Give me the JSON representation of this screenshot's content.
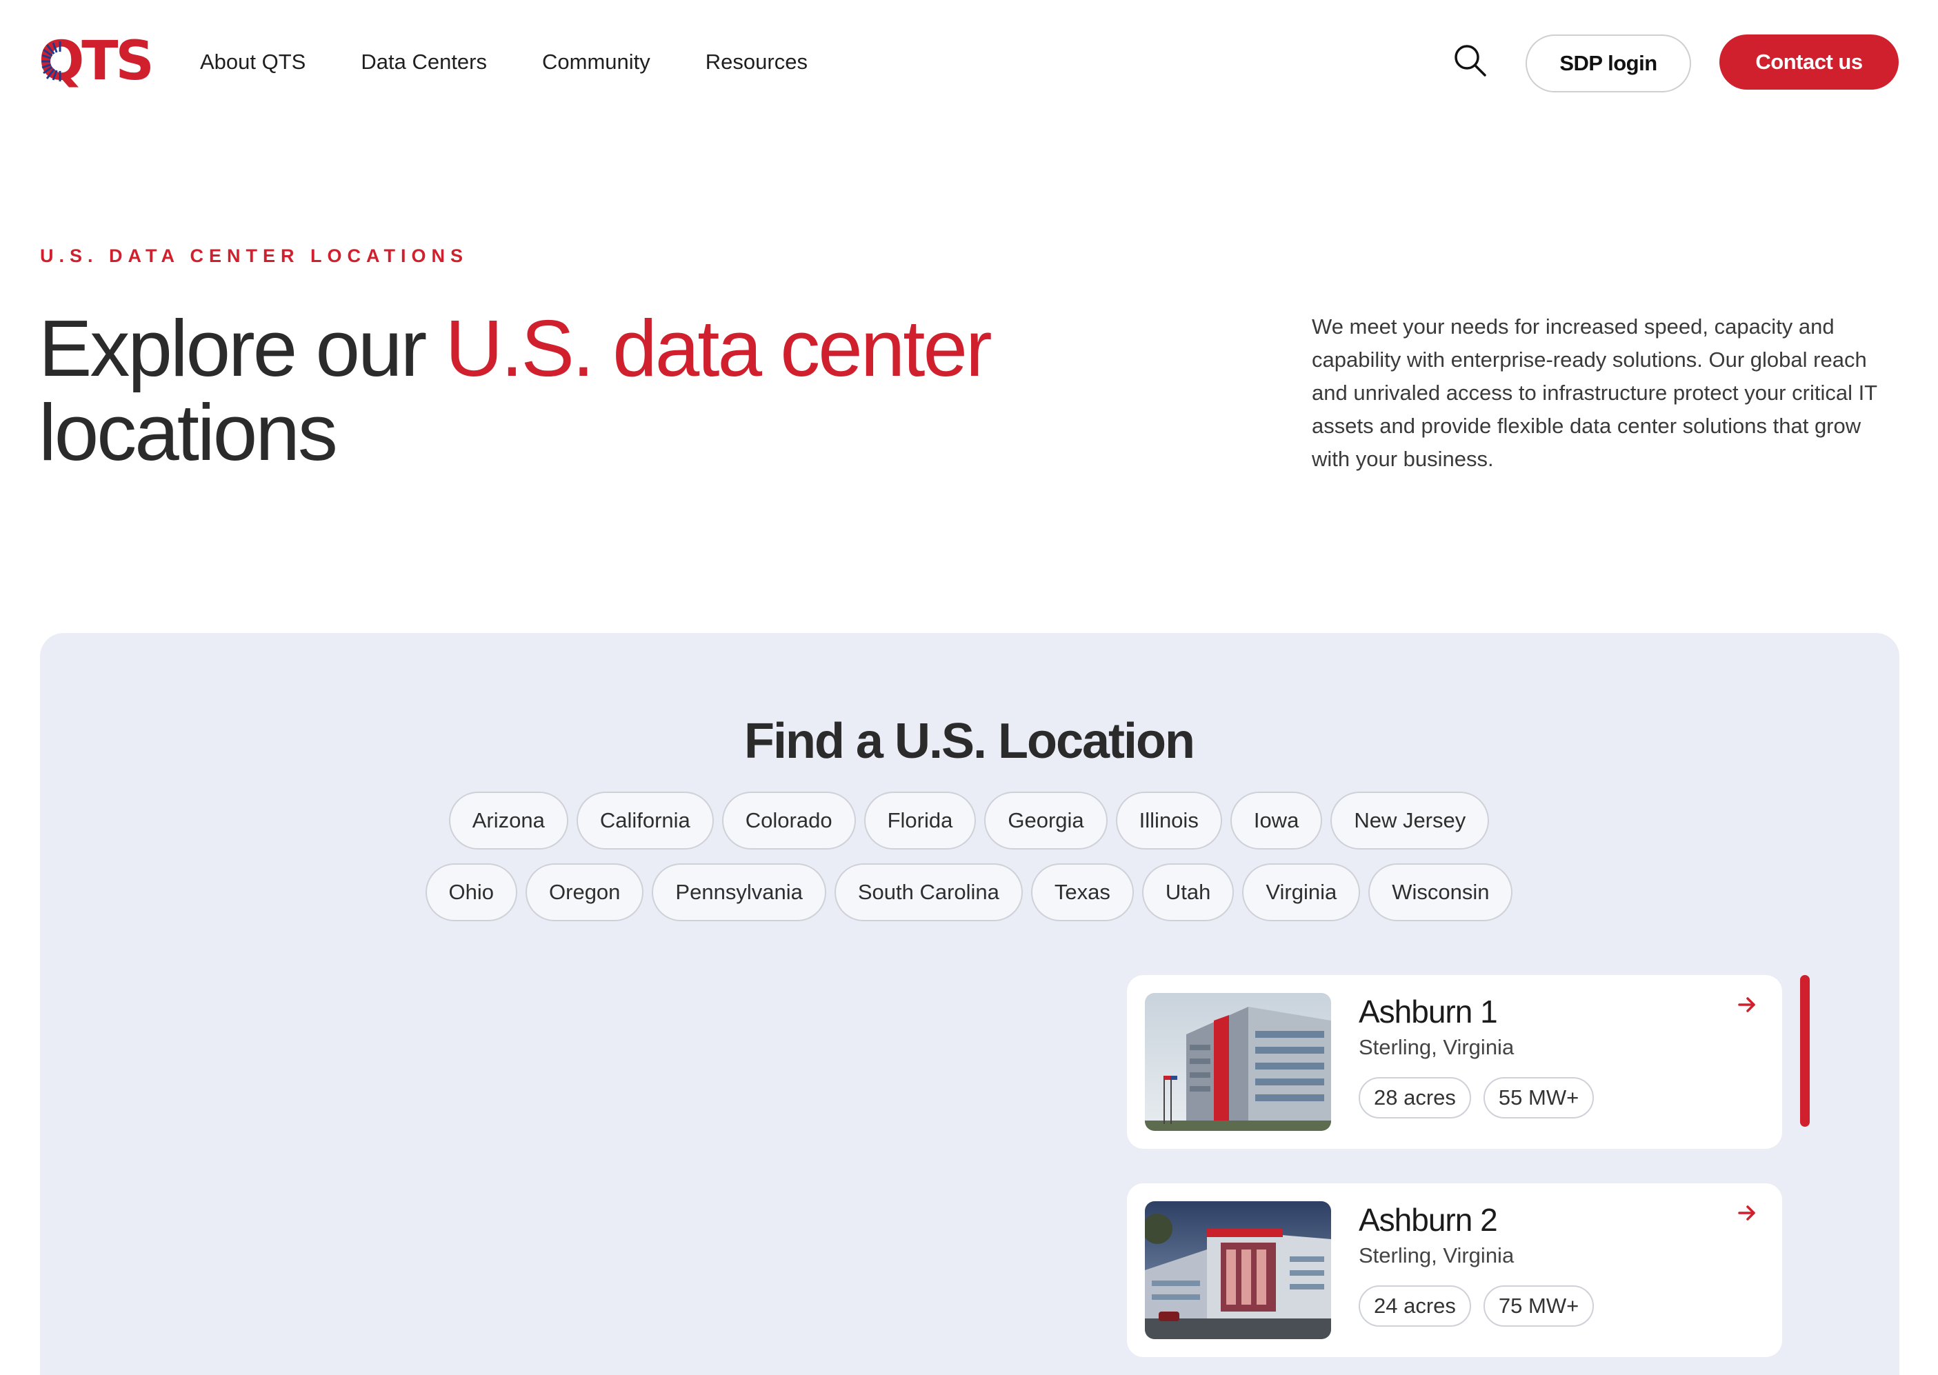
{
  "brand": {
    "logo_text": "QTS",
    "accent_color": "#d0202e",
    "logo_ring_color": "#1f3a8a"
  },
  "nav": {
    "items": [
      {
        "label": "About QTS"
      },
      {
        "label": "Data Centers"
      },
      {
        "label": "Community"
      },
      {
        "label": "Resources"
      }
    ],
    "search_icon": "search-icon",
    "sdp_login": "SDP login",
    "contact": "Contact us"
  },
  "hero": {
    "eyebrow": "U.S. DATA CENTER LOCATIONS",
    "title_prefix": "Explore our ",
    "title_accent": "U.S. data center",
    "title_suffix": "locations",
    "description": "We meet your needs for increased speed, capacity and capability with enterprise-ready solutions. Our global reach and unrivaled access to infrastructure protect your critical IT assets and provide flexible data center solutions that grow with your business."
  },
  "finder": {
    "title": "Find a U.S. Location",
    "states_row1": [
      "Arizona",
      "California",
      "Colorado",
      "Florida",
      "Georgia",
      "Illinois",
      "Iowa",
      "New Jersey"
    ],
    "states_row2": [
      "Ohio",
      "Oregon",
      "Pennsylvania",
      "South Carolina",
      "Texas",
      "Utah",
      "Virginia",
      "Wisconsin"
    ]
  },
  "locations": [
    {
      "name": "Ashburn 1",
      "city": "Sterling,",
      "state": "Virginia",
      "acres": "28 acres",
      "power": "55 MW+",
      "arrow_icon": "arrow-right-icon"
    },
    {
      "name": "Ashburn 2",
      "city": "Sterling,",
      "state": "Virginia",
      "acres": "24 acres",
      "power": "75 MW+",
      "arrow_icon": "arrow-right-icon"
    }
  ]
}
